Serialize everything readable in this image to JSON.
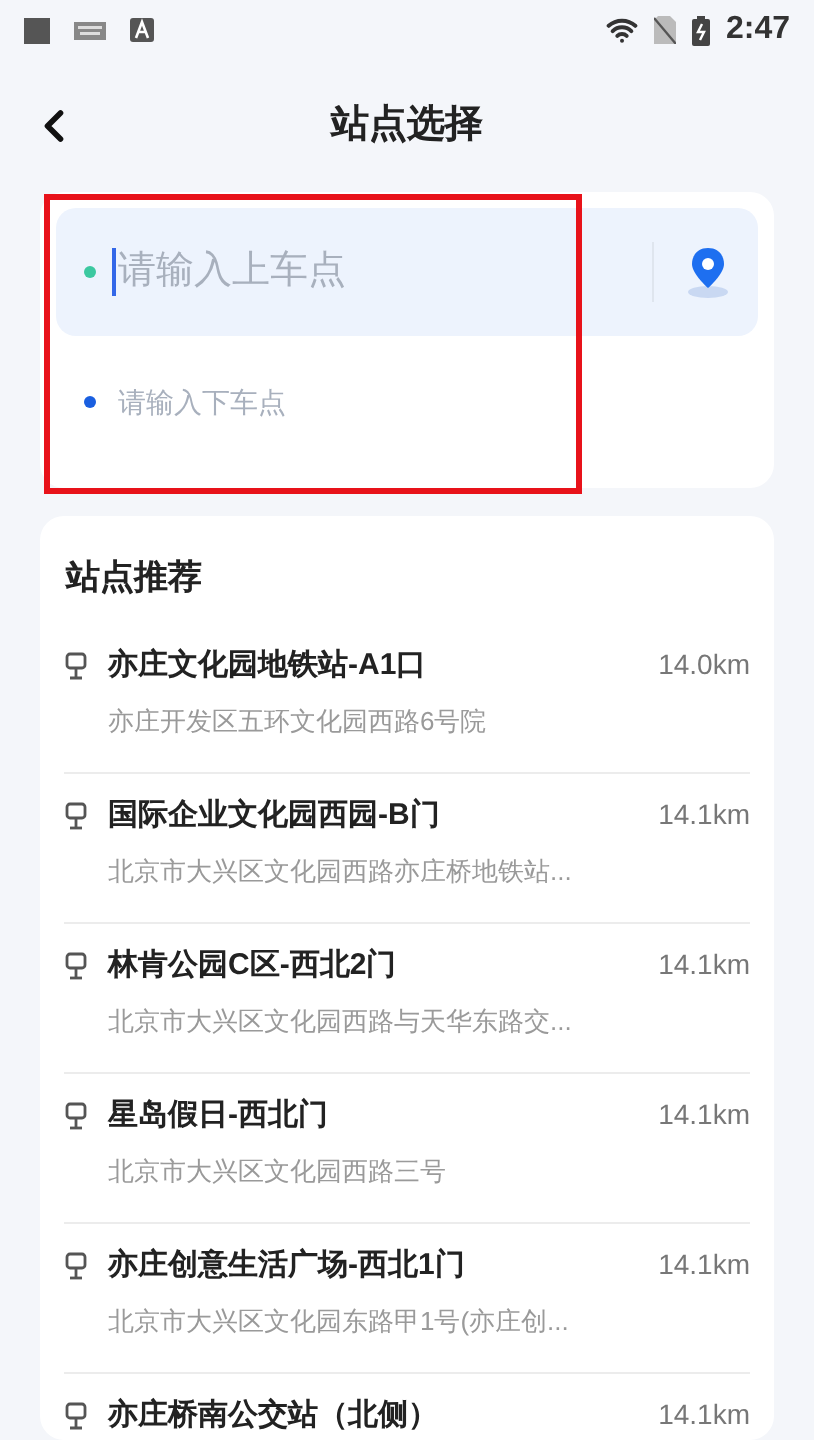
{
  "status_bar": {
    "time": "2:47"
  },
  "header": {
    "title": "站点选择"
  },
  "route": {
    "pickup": {
      "placeholder": "请输入上车点",
      "color": "#3cc8a0"
    },
    "dropoff": {
      "placeholder": "请输入下车点",
      "color": "#1a5fe0"
    }
  },
  "recommendations": {
    "title": "站点推荐",
    "items": [
      {
        "name": "亦庄文化园地铁站-A1口",
        "address": "亦庄开发区五环文化园西路6号院",
        "distance": "14.0km"
      },
      {
        "name": "国际企业文化园西园-B门",
        "address": "北京市大兴区文化园西路亦庄桥地铁站...",
        "distance": "14.1km"
      },
      {
        "name": "林肯公园C区-西北2门",
        "address": "北京市大兴区文化园西路与天华东路交...",
        "distance": "14.1km"
      },
      {
        "name": "星岛假日-西北门",
        "address": "北京市大兴区文化园西路三号",
        "distance": "14.1km"
      },
      {
        "name": "亦庄创意生活广场-西北1门",
        "address": "北京市大兴区文化园东路甲1号(亦庄创...",
        "distance": "14.1km"
      },
      {
        "name": "亦庄桥南公交站（北侧）",
        "distance": "14.1km"
      }
    ]
  }
}
